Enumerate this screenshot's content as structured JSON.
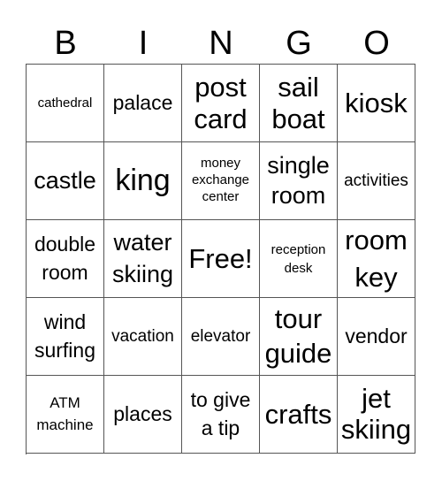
{
  "header": [
    "B",
    "I",
    "N",
    "G",
    "O"
  ],
  "cells": [
    [
      "cathedral",
      "palace",
      "post card",
      "sail boat",
      "kiosk"
    ],
    [
      "castle",
      "king",
      "money exchange center",
      "single room",
      "activities"
    ],
    [
      "double room",
      "water skiing",
      "Free!",
      "reception desk",
      "room key"
    ],
    [
      "wind surfing",
      "vacation",
      "elevator",
      "tour guide",
      "vendor"
    ],
    [
      "ATM machine",
      "places",
      "to give a tip",
      "crafts",
      "jet skiing"
    ]
  ]
}
